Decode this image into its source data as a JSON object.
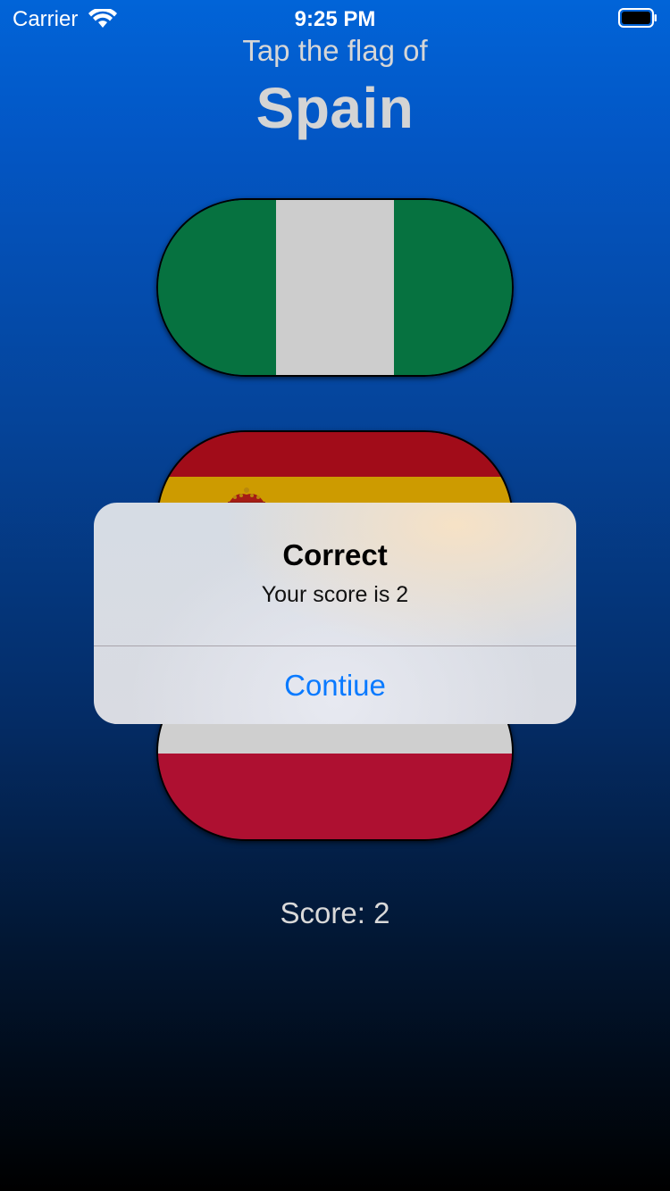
{
  "status_bar": {
    "carrier": "Carrier",
    "time": "9:25 PM",
    "wifi_icon": "wifi-icon",
    "battery_icon": "battery-icon"
  },
  "header": {
    "prompt": "Tap the flag of",
    "country": "Spain"
  },
  "flags": [
    {
      "name": "nigeria-flag",
      "colors": [
        "#067240",
        "#cdcdcd",
        "#067240"
      ]
    },
    {
      "name": "spain-flag",
      "colors": [
        "#a10c19",
        "#cd9b00",
        "#a10c19"
      ]
    },
    {
      "name": "poland-flag",
      "colors": [
        "#cfcfcf",
        "#ae1031"
      ]
    }
  ],
  "score_label": "Score: 2",
  "alert": {
    "title": "Correct",
    "message": "Your score is 2",
    "button_label": "Contiue",
    "button_color": "#0a7aff"
  }
}
